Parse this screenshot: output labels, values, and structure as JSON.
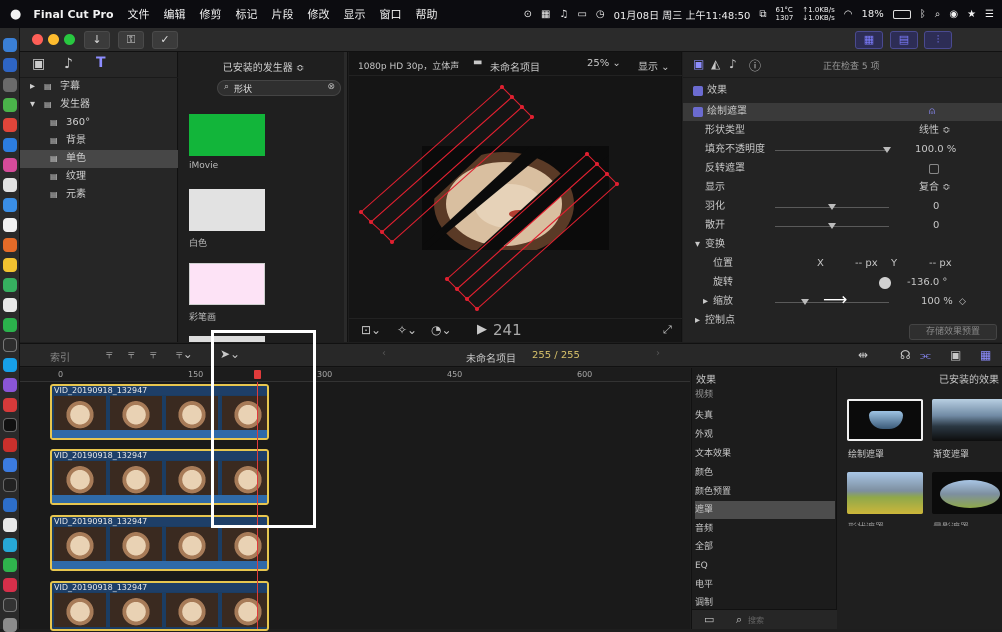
{
  "menubar": {
    "app_name": "Final Cut Pro",
    "items": [
      "文件",
      "编辑",
      "修剪",
      "标记",
      "片段",
      "修改",
      "显示",
      "窗口",
      "帮助"
    ],
    "status": {
      "datetime": "01月08日 周三 上午11:48:50",
      "cpu_temp": "61°C",
      "cpu_fan": "1307",
      "net_up": "↑1.0KB/s",
      "net_down": "↓1.0KB/s",
      "battery": "18%"
    }
  },
  "library": {
    "items": [
      {
        "label": "字幕"
      },
      {
        "label": "发生器"
      },
      {
        "label": "360°"
      },
      {
        "label": "背景"
      },
      {
        "label": "单色"
      },
      {
        "label": "纹理"
      },
      {
        "label": "元素"
      }
    ]
  },
  "generators": {
    "header": "已安装的发生器 ≎",
    "search_value": "形状",
    "items": [
      {
        "label": "iMovie",
        "color": "#12b53a"
      },
      {
        "label": "白色",
        "color": "#e2e2e2"
      },
      {
        "label": "彩笔画",
        "color": "#fde3f6"
      }
    ]
  },
  "viewer": {
    "format": "1080p HD 30p，立体声",
    "project": "未命名项目",
    "zoom": "25%",
    "display_menu": "显示",
    "timecode": "241"
  },
  "inspector": {
    "status": "正在检查 5 项",
    "section": "效果",
    "effect_name": "绘制遮罩",
    "rows": {
      "shape_type": {
        "label": "形状类型",
        "value": "线性 ≎"
      },
      "fill_opacity": {
        "label": "填充不透明度",
        "value": "100.0 %"
      },
      "invert": {
        "label": "反转遮罩"
      },
      "display": {
        "label": "显示",
        "value": "复合 ≎"
      },
      "feather": {
        "label": "羽化",
        "value": "0"
      },
      "spread": {
        "label": "散开",
        "value": "0"
      },
      "transform": {
        "label": "变换"
      },
      "position": {
        "label": "位置",
        "x_label": "X",
        "x_value": "-- px",
        "y_label": "Y",
        "y_value": "-- px"
      },
      "rotation": {
        "label": "旋转",
        "value": "-136.0 °"
      },
      "scale": {
        "label": "缩放",
        "value": "100 %"
      },
      "control_points": {
        "label": "控制点"
      }
    },
    "save_preset": "存储效果预置"
  },
  "timeline": {
    "index_label": "索引",
    "project_name": "未命名项目",
    "counter": "255 / 255",
    "ruler_ticks": [
      "0",
      "150",
      "300",
      "450",
      "600"
    ],
    "clips": [
      {
        "name": "VID_20190918_132947"
      },
      {
        "name": "VID_20190918_132947"
      },
      {
        "name": "VID_20190918_132947"
      },
      {
        "name": "VID_20190918_132947"
      }
    ]
  },
  "effects_browser": {
    "header": "效果",
    "installed_header": "已安装的效果",
    "categories": [
      "视频",
      "失真",
      "外观",
      "文本效果",
      "颜色",
      "颜色预置",
      "遮罩",
      "音频",
      "全部",
      "EQ",
      "电平",
      "调制"
    ],
    "selected_category": "遮罩",
    "search_placeholder": "搜索",
    "thumbnails": [
      {
        "label": "绘制遮罩"
      },
      {
        "label": "渐变遮罩"
      },
      {
        "label": "形状遮罩"
      },
      {
        "label": "晕影遮罩"
      }
    ]
  }
}
